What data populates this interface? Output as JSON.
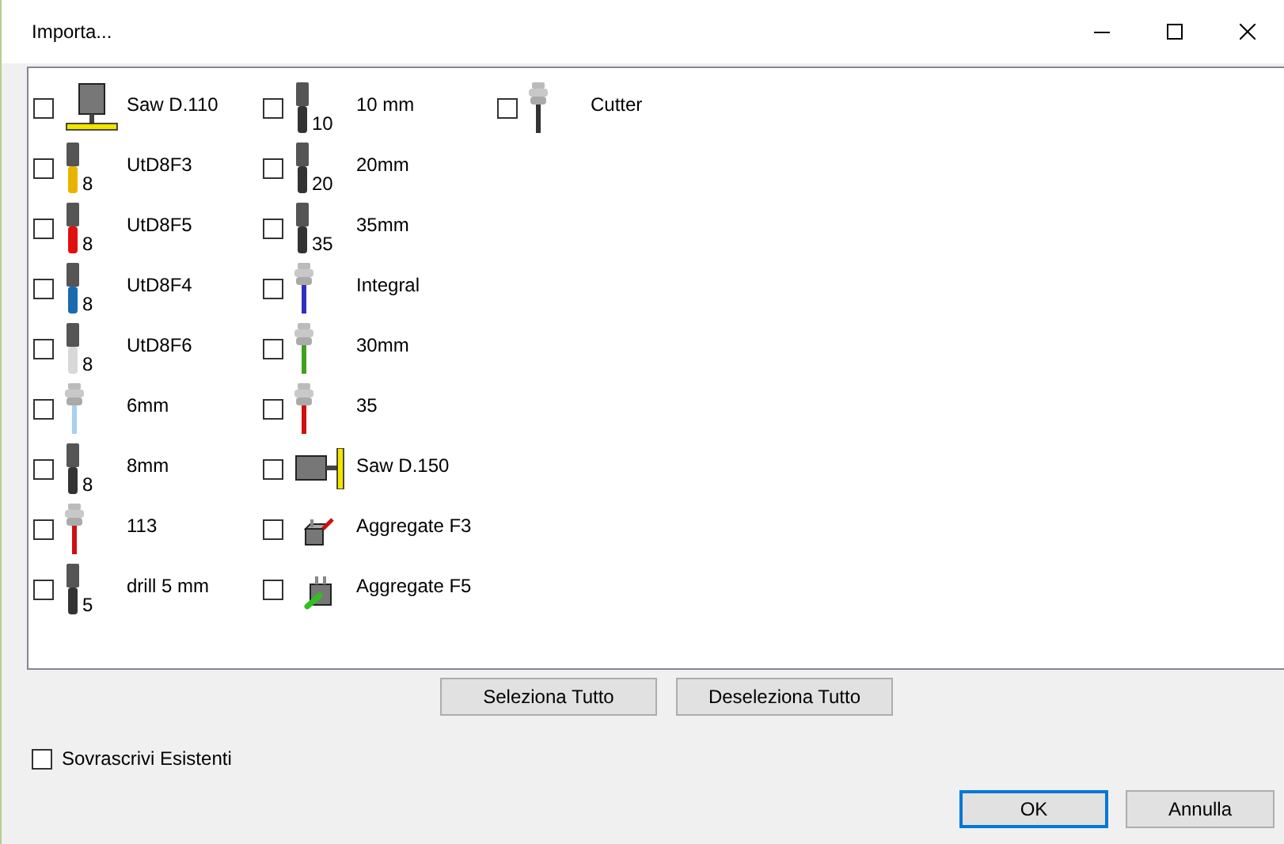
{
  "window": {
    "title": "Importa..."
  },
  "columns": [
    [
      {
        "kind": "saw-vertical",
        "label": "Saw D.110",
        "checked": false
      },
      {
        "kind": "tool",
        "label": "UtD8F3",
        "size": "8",
        "color": "#e8b400",
        "checked": false
      },
      {
        "kind": "tool",
        "label": "UtD8F5",
        "size": "8",
        "color": "#e01010",
        "checked": false
      },
      {
        "kind": "tool",
        "label": "UtD8F4",
        "size": "8",
        "color": "#1a6ab0",
        "checked": false
      },
      {
        "kind": "tool",
        "label": "UtD8F6",
        "size": "8",
        "color": "#d8d8d8",
        "checked": false
      },
      {
        "kind": "collet",
        "label": "6mm",
        "color": "#a8d0f0",
        "checked": false
      },
      {
        "kind": "tool",
        "label": "8mm",
        "size": "8",
        "color": "#333333",
        "checked": false
      },
      {
        "kind": "collet",
        "label": "113",
        "color": "#d01010",
        "checked": false
      },
      {
        "kind": "tool",
        "label": "drill 5 mm",
        "size": "5",
        "color": "#333333",
        "checked": false
      }
    ],
    [
      {
        "kind": "tool",
        "label": "10 mm",
        "size": "10",
        "color": "#333333",
        "checked": false
      },
      {
        "kind": "tool",
        "label": "20mm",
        "size": "20",
        "color": "#333333",
        "checked": false
      },
      {
        "kind": "tool",
        "label": "35mm",
        "size": "35",
        "color": "#333333",
        "checked": false
      },
      {
        "kind": "collet",
        "label": "Integral",
        "color": "#3030c0",
        "checked": false
      },
      {
        "kind": "collet",
        "label": "30mm",
        "color": "#40a020",
        "checked": false
      },
      {
        "kind": "collet",
        "label": "35",
        "color": "#d01010",
        "checked": false
      },
      {
        "kind": "saw-horizontal",
        "label": "Saw D.150",
        "checked": false
      },
      {
        "kind": "aggregate-f3",
        "label": "Aggregate F3",
        "checked": false
      },
      {
        "kind": "aggregate-f5",
        "label": "Aggregate F5",
        "checked": false
      }
    ],
    [
      {
        "kind": "collet",
        "label": "Cutter",
        "color": "#333333",
        "checked": false
      }
    ]
  ],
  "select_buttons": [
    "Seleziona Tutto",
    "Deseleziona Tutto"
  ],
  "overwrite": {
    "label": "Sovrascrivi Esistenti",
    "checked": false
  },
  "buttons": [
    {
      "label": "OK",
      "default": true
    },
    {
      "label": "Annulla",
      "default": false
    }
  ]
}
